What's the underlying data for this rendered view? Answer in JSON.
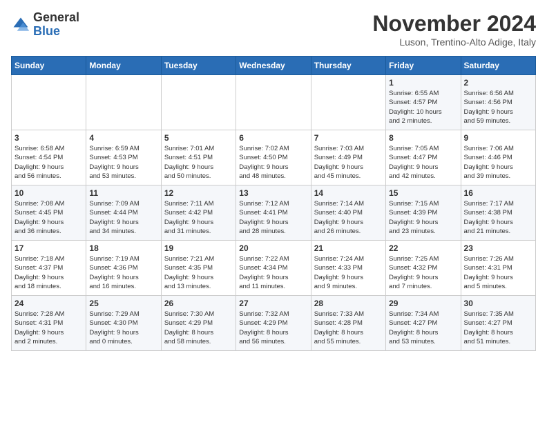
{
  "logo": {
    "general": "General",
    "blue": "Blue"
  },
  "title": "November 2024",
  "location": "Luson, Trentino-Alto Adige, Italy",
  "days_of_week": [
    "Sunday",
    "Monday",
    "Tuesday",
    "Wednesday",
    "Thursday",
    "Friday",
    "Saturday"
  ],
  "weeks": [
    [
      {
        "day": "",
        "info": ""
      },
      {
        "day": "",
        "info": ""
      },
      {
        "day": "",
        "info": ""
      },
      {
        "day": "",
        "info": ""
      },
      {
        "day": "",
        "info": ""
      },
      {
        "day": "1",
        "info": "Sunrise: 6:55 AM\nSunset: 4:57 PM\nDaylight: 10 hours\nand 2 minutes."
      },
      {
        "day": "2",
        "info": "Sunrise: 6:56 AM\nSunset: 4:56 PM\nDaylight: 9 hours\nand 59 minutes."
      }
    ],
    [
      {
        "day": "3",
        "info": "Sunrise: 6:58 AM\nSunset: 4:54 PM\nDaylight: 9 hours\nand 56 minutes."
      },
      {
        "day": "4",
        "info": "Sunrise: 6:59 AM\nSunset: 4:53 PM\nDaylight: 9 hours\nand 53 minutes."
      },
      {
        "day": "5",
        "info": "Sunrise: 7:01 AM\nSunset: 4:51 PM\nDaylight: 9 hours\nand 50 minutes."
      },
      {
        "day": "6",
        "info": "Sunrise: 7:02 AM\nSunset: 4:50 PM\nDaylight: 9 hours\nand 48 minutes."
      },
      {
        "day": "7",
        "info": "Sunrise: 7:03 AM\nSunset: 4:49 PM\nDaylight: 9 hours\nand 45 minutes."
      },
      {
        "day": "8",
        "info": "Sunrise: 7:05 AM\nSunset: 4:47 PM\nDaylight: 9 hours\nand 42 minutes."
      },
      {
        "day": "9",
        "info": "Sunrise: 7:06 AM\nSunset: 4:46 PM\nDaylight: 9 hours\nand 39 minutes."
      }
    ],
    [
      {
        "day": "10",
        "info": "Sunrise: 7:08 AM\nSunset: 4:45 PM\nDaylight: 9 hours\nand 36 minutes."
      },
      {
        "day": "11",
        "info": "Sunrise: 7:09 AM\nSunset: 4:44 PM\nDaylight: 9 hours\nand 34 minutes."
      },
      {
        "day": "12",
        "info": "Sunrise: 7:11 AM\nSunset: 4:42 PM\nDaylight: 9 hours\nand 31 minutes."
      },
      {
        "day": "13",
        "info": "Sunrise: 7:12 AM\nSunset: 4:41 PM\nDaylight: 9 hours\nand 28 minutes."
      },
      {
        "day": "14",
        "info": "Sunrise: 7:14 AM\nSunset: 4:40 PM\nDaylight: 9 hours\nand 26 minutes."
      },
      {
        "day": "15",
        "info": "Sunrise: 7:15 AM\nSunset: 4:39 PM\nDaylight: 9 hours\nand 23 minutes."
      },
      {
        "day": "16",
        "info": "Sunrise: 7:17 AM\nSunset: 4:38 PM\nDaylight: 9 hours\nand 21 minutes."
      }
    ],
    [
      {
        "day": "17",
        "info": "Sunrise: 7:18 AM\nSunset: 4:37 PM\nDaylight: 9 hours\nand 18 minutes."
      },
      {
        "day": "18",
        "info": "Sunrise: 7:19 AM\nSunset: 4:36 PM\nDaylight: 9 hours\nand 16 minutes."
      },
      {
        "day": "19",
        "info": "Sunrise: 7:21 AM\nSunset: 4:35 PM\nDaylight: 9 hours\nand 13 minutes."
      },
      {
        "day": "20",
        "info": "Sunrise: 7:22 AM\nSunset: 4:34 PM\nDaylight: 9 hours\nand 11 minutes."
      },
      {
        "day": "21",
        "info": "Sunrise: 7:24 AM\nSunset: 4:33 PM\nDaylight: 9 hours\nand 9 minutes."
      },
      {
        "day": "22",
        "info": "Sunrise: 7:25 AM\nSunset: 4:32 PM\nDaylight: 9 hours\nand 7 minutes."
      },
      {
        "day": "23",
        "info": "Sunrise: 7:26 AM\nSunset: 4:31 PM\nDaylight: 9 hours\nand 5 minutes."
      }
    ],
    [
      {
        "day": "24",
        "info": "Sunrise: 7:28 AM\nSunset: 4:31 PM\nDaylight: 9 hours\nand 2 minutes."
      },
      {
        "day": "25",
        "info": "Sunrise: 7:29 AM\nSunset: 4:30 PM\nDaylight: 9 hours\nand 0 minutes."
      },
      {
        "day": "26",
        "info": "Sunrise: 7:30 AM\nSunset: 4:29 PM\nDaylight: 8 hours\nand 58 minutes."
      },
      {
        "day": "27",
        "info": "Sunrise: 7:32 AM\nSunset: 4:29 PM\nDaylight: 8 hours\nand 56 minutes."
      },
      {
        "day": "28",
        "info": "Sunrise: 7:33 AM\nSunset: 4:28 PM\nDaylight: 8 hours\nand 55 minutes."
      },
      {
        "day": "29",
        "info": "Sunrise: 7:34 AM\nSunset: 4:27 PM\nDaylight: 8 hours\nand 53 minutes."
      },
      {
        "day": "30",
        "info": "Sunrise: 7:35 AM\nSunset: 4:27 PM\nDaylight: 8 hours\nand 51 minutes."
      }
    ]
  ]
}
